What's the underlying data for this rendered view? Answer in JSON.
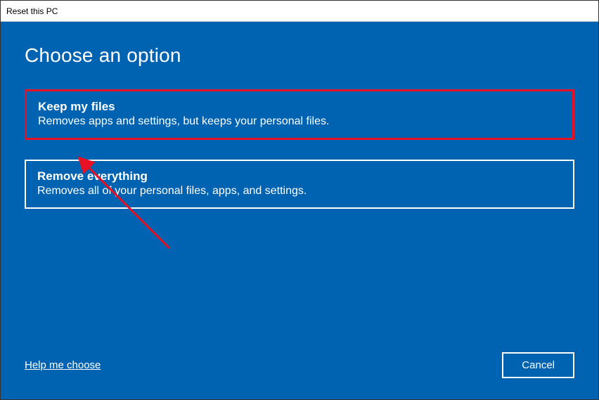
{
  "window": {
    "title": "Reset this PC"
  },
  "page": {
    "heading": "Choose an option"
  },
  "options": {
    "keep": {
      "title": "Keep my files",
      "desc": "Removes apps and settings, but keeps your personal files."
    },
    "remove": {
      "title": "Remove everything",
      "desc": "Removes all of your personal files, apps, and settings."
    }
  },
  "footer": {
    "help_link": "Help me choose",
    "cancel_label": "Cancel"
  },
  "annotation": {
    "highlight_color": "#e81123"
  }
}
